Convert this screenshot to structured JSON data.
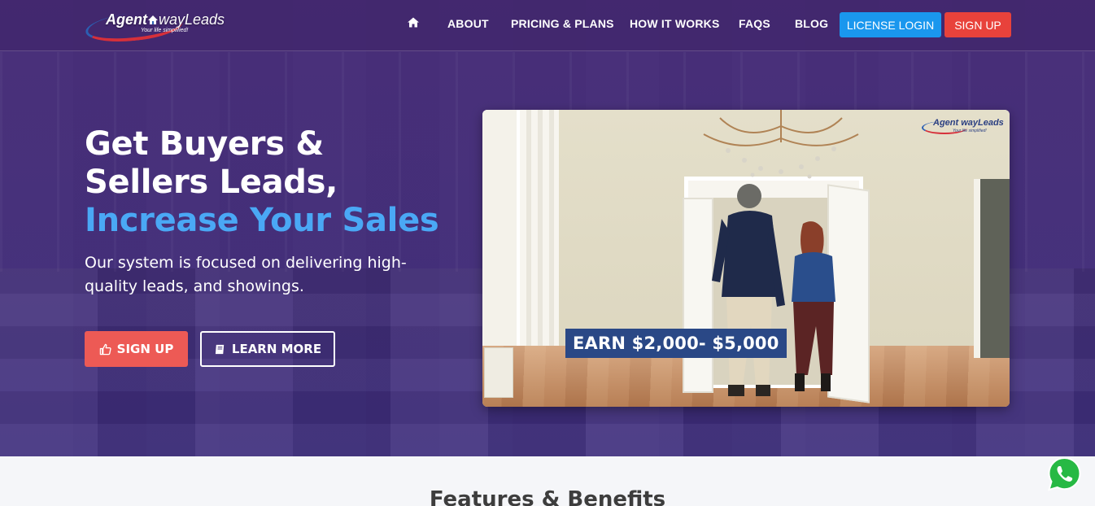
{
  "header": {
    "logo": {
      "brand_bold": "Agent",
      "brand_light": "wayLeads",
      "tagline": "Your life simplified!"
    },
    "nav_items": [
      {
        "label": "ABOUT"
      },
      {
        "label": "PRICING & PLANS"
      },
      {
        "label": "HOW IT WORKS"
      },
      {
        "label": "FAQS"
      },
      {
        "label": "BLOG"
      }
    ],
    "license_login_label": "LICENSE LOGIN",
    "signup_label": "SIGN UP",
    "license_color": "#1a97ee",
    "signup_color": "#e8423b"
  },
  "hero": {
    "headline_line1": "Get Buyers &",
    "headline_line2": "Sellers Leads,",
    "headline_accent": "Increase Your Sales",
    "subtext": "Our system is focused on delivering high-quality leads, and showings.",
    "signup_label": "SIGN UP",
    "learn_more_label": "LEARN MORE",
    "accent_color": "#4aa8f5"
  },
  "video": {
    "logo_text": "Agent wayLeads",
    "logo_tagline": "Your life simplified!",
    "caption": "EARN $2,000- $5,000"
  },
  "features": {
    "title": "Features & Benefits"
  },
  "floating": {
    "whatsapp_icon": "whatsapp-icon"
  }
}
